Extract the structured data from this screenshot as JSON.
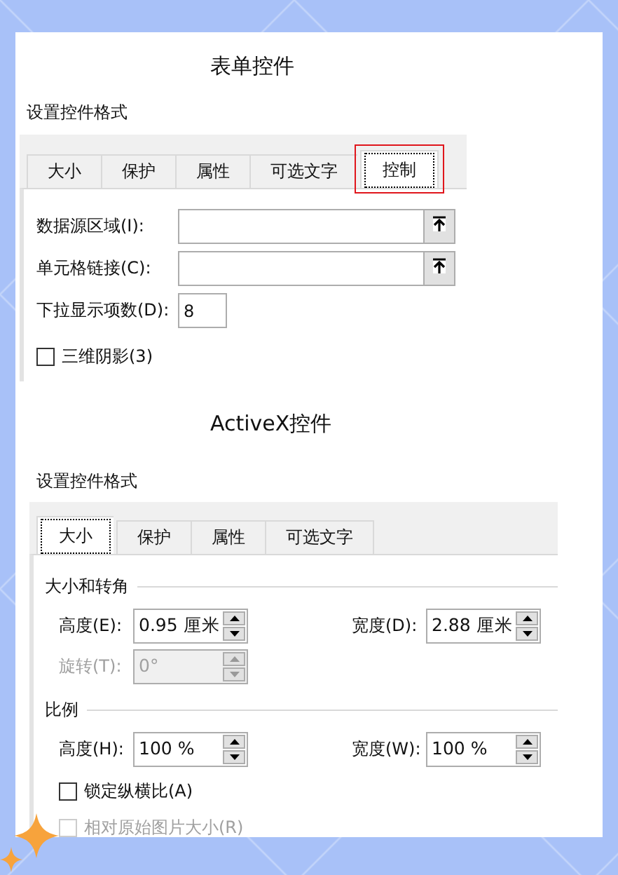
{
  "form_controls": {
    "title": "表单控件",
    "subtitle": "设置控件格式",
    "tabs": [
      {
        "label": "大小",
        "selected": false,
        "highlighted": false
      },
      {
        "label": "保护",
        "selected": false,
        "highlighted": false
      },
      {
        "label": "属性",
        "selected": false,
        "highlighted": false
      },
      {
        "label": "可选文字",
        "selected": false,
        "highlighted": false
      },
      {
        "label": "控制",
        "selected": true,
        "highlighted": true
      }
    ],
    "fields": [
      {
        "kind": "range",
        "label": "数据源区域(I):"
      },
      {
        "kind": "range",
        "label": "单元格链接(C):"
      },
      {
        "kind": "number",
        "label": "下拉显示项数(D):",
        "value": "8"
      }
    ],
    "checkboxes": [
      {
        "label": "三维阴影(3)",
        "checked": false,
        "disabled": false
      }
    ]
  },
  "activex_controls": {
    "title": "ActiveX控件",
    "subtitle": "设置控件格式",
    "tabs": [
      {
        "label": "大小",
        "selected": true,
        "highlighted": false
      },
      {
        "label": "保护",
        "selected": false,
        "highlighted": false
      },
      {
        "label": "属性",
        "selected": false,
        "highlighted": false
      },
      {
        "label": "可选文字",
        "selected": false,
        "highlighted": false
      }
    ],
    "groups": [
      {
        "title": "大小和转角",
        "rows": [
          [
            {
              "label": "高度(E):",
              "value": "0.95 厘米",
              "disabled": false
            },
            {
              "label": "宽度(D):",
              "value": "2.88 厘米",
              "disabled": false
            }
          ],
          [
            {
              "label": "旋转(T):",
              "value": "0°",
              "disabled": true
            }
          ]
        ]
      },
      {
        "title": "比例",
        "rows": [
          [
            {
              "label": "高度(H):",
              "value": "100 %",
              "disabled": false
            },
            {
              "label": "宽度(W):",
              "value": "100 %",
              "disabled": false
            }
          ]
        ]
      }
    ],
    "checkboxes": [
      {
        "label": "锁定纵横比(A)",
        "checked": false,
        "disabled": false
      },
      {
        "label": "相对原始图片大小(R)",
        "checked": false,
        "disabled": true
      }
    ]
  }
}
